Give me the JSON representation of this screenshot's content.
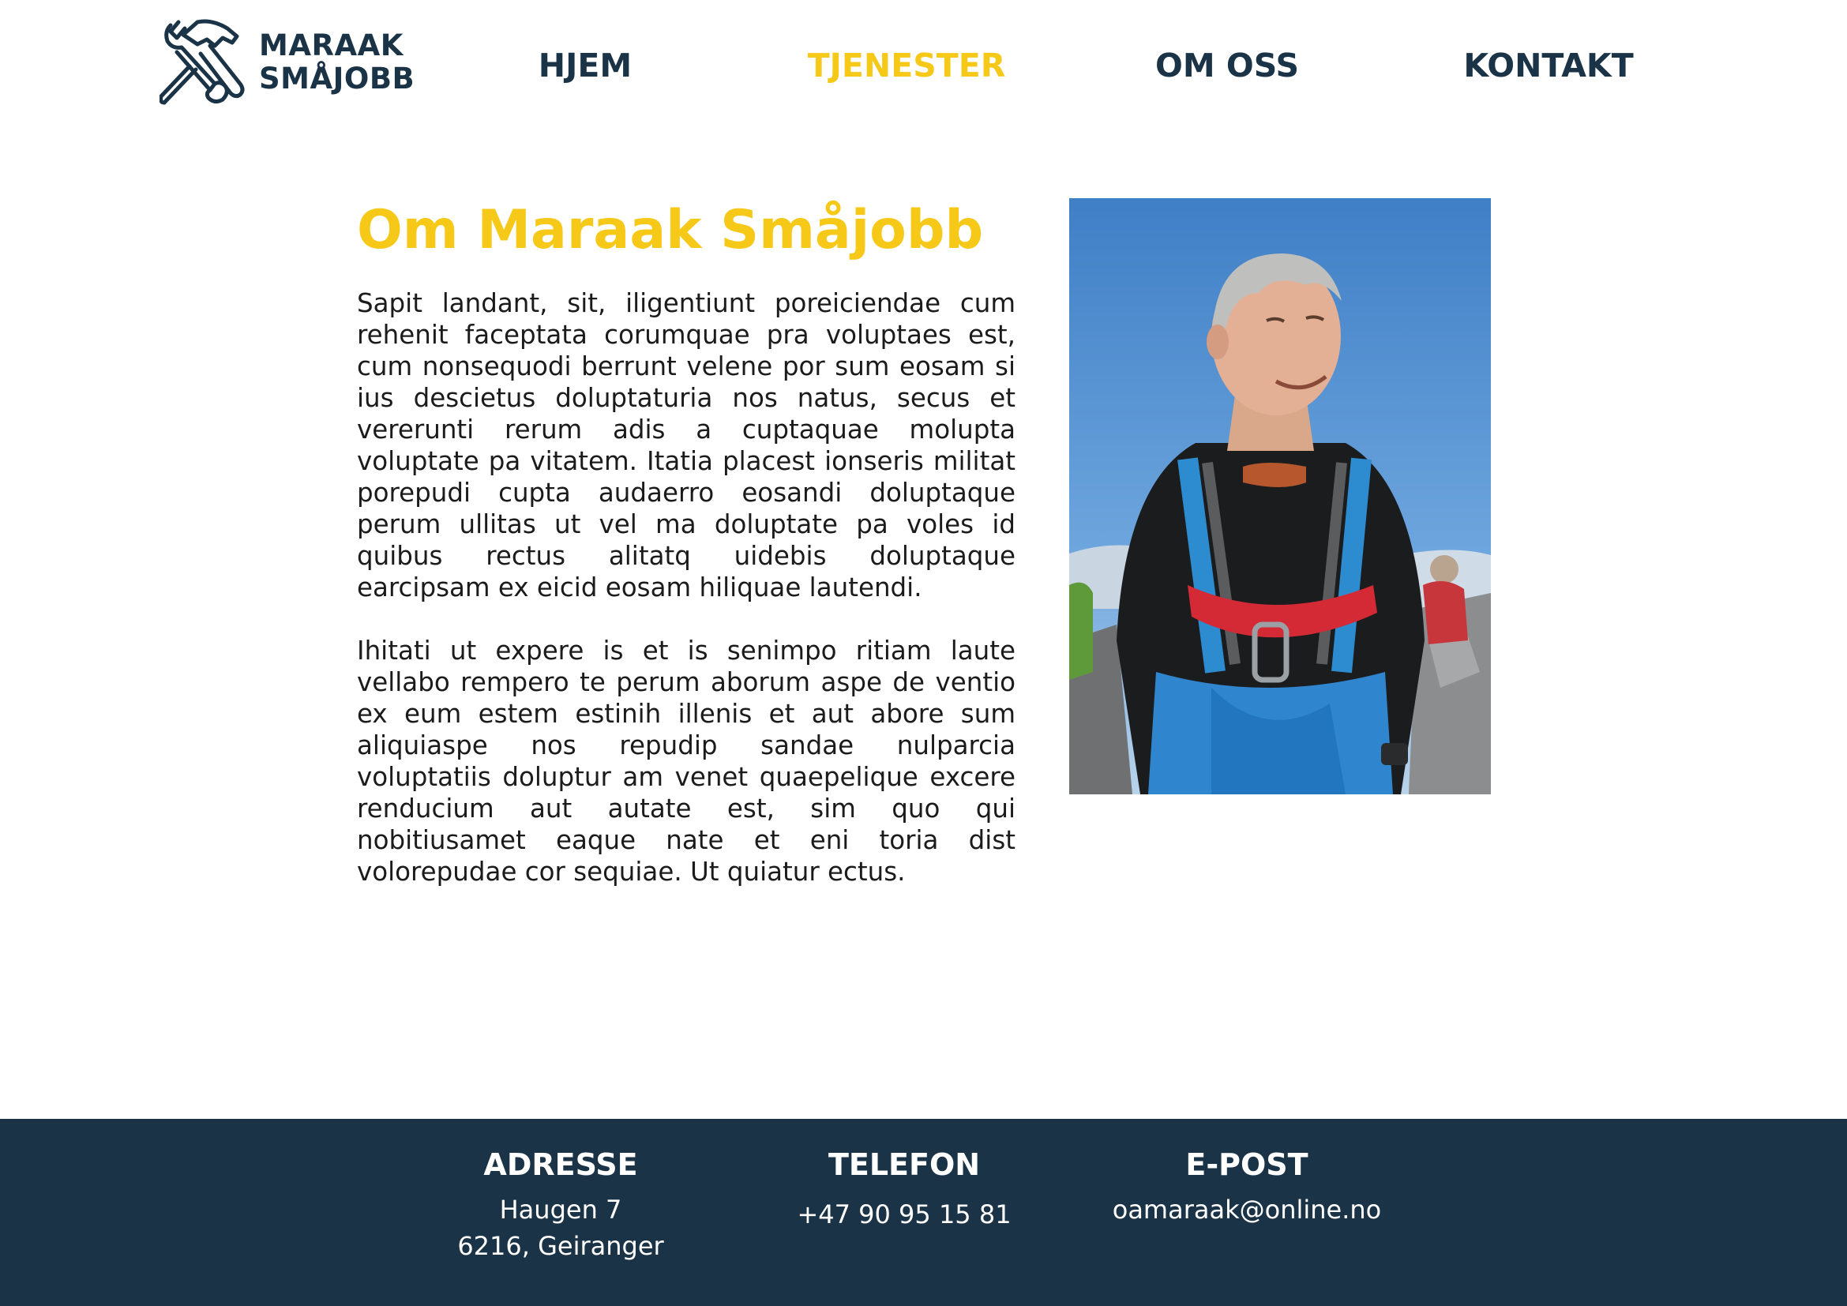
{
  "brand": {
    "line1": "MARAAK",
    "line2": "SMÅJOBB",
    "icon": "hammer-wrench-icon",
    "color": "#1b3346"
  },
  "nav": {
    "home": "HJEM",
    "services": "TJENESTER",
    "about": "OM OSS",
    "contact": "KONTAKT",
    "active": "services"
  },
  "colors": {
    "accent": "#f6c818",
    "navy": "#1b3346"
  },
  "about": {
    "title": "Om Maraak Småjobb",
    "paragraph1": "Sapit landant, sit, iligentiunt poreiciendae cum rehenit faceptata corumquae pra voluptaes est, cum nonsequodi berrunt velene por sum eosam si ius descietus doluptaturia nos natus, secus et vererunti rerum adis a cuptaquae molupta voluptate pa vitatem. Itatia placest ionseris militat porepudi cupta audaerro eosandi doluptaque perum ullitas ut vel ma doluptate pa voles id quibus rectus alitatq uidebis doluptaque earcipsam ex eicid eosam hiliquae lautendi.",
    "paragraph2": "Ihitati ut expere is et is senimpo ritiam laute vellabo rempero te perum aborum aspe de ventio ex eum estem estinih illenis et aut abore sum aliquiaspe nos repudip sandae nulparcia voluptatiis doluptur am venet quaepelique excere renducium aut autate est, sim quo qui nobitiusamet eaque nate et eni toria dist volorepudae cor sequiae. Ut quiatur ectus."
  },
  "footer": {
    "address": {
      "heading": "ADRESSE",
      "line1": "Haugen 7",
      "line2": "6216, Geiranger"
    },
    "phone": {
      "heading": "TELEFON",
      "value": "+47 90 95 15 81"
    },
    "email": {
      "heading": "E-POST",
      "value": "oamaraak@online.no"
    }
  }
}
